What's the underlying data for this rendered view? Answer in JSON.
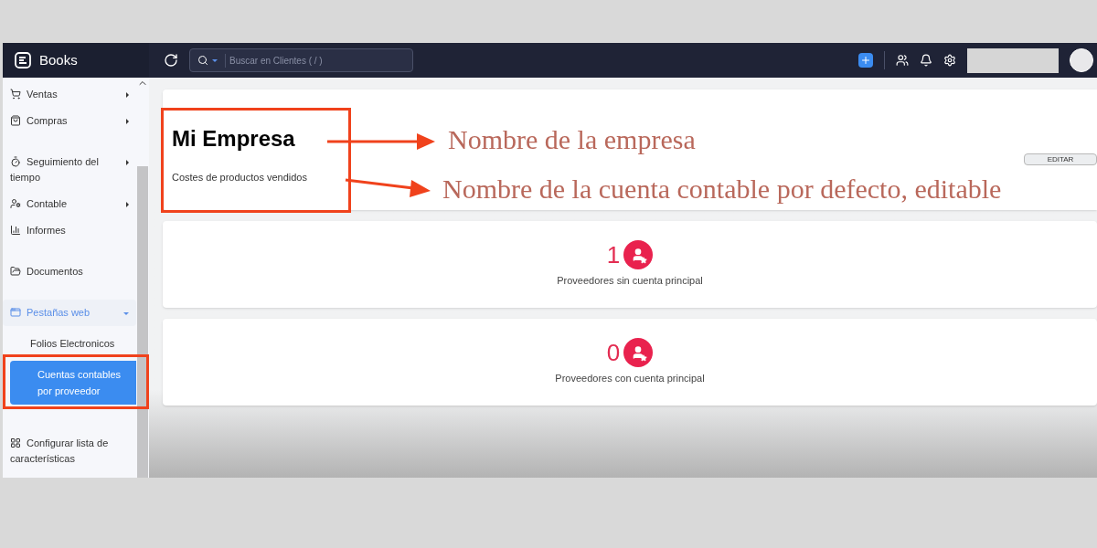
{
  "app": {
    "name": "Books"
  },
  "search": {
    "placeholder": "Buscar en Clientes ( / )"
  },
  "sidebar": {
    "items": [
      {
        "label": "Ventas",
        "expandable": true,
        "expanded": false,
        "active": false
      },
      {
        "label": "Compras",
        "expandable": true,
        "expanded": false,
        "active": false
      },
      {
        "label": "Seguimiento del tiempo",
        "expandable": true,
        "expanded": false,
        "active": false
      },
      {
        "label": "Contable",
        "expandable": true,
        "expanded": false,
        "active": false
      },
      {
        "label": "Informes",
        "expandable": false,
        "active": false
      },
      {
        "label": "Documentos",
        "expandable": false,
        "active": false
      },
      {
        "label": "Pestañas web",
        "expandable": true,
        "expanded": true,
        "active": true,
        "children": [
          {
            "label": "Folios Electronicos",
            "selected": false
          },
          {
            "label": "Cuentas contables por proveedor",
            "selected": true
          }
        ]
      }
    ],
    "footer_item": {
      "label": "Configurar lista de características"
    }
  },
  "company_card": {
    "title": "Mi Empresa",
    "account": "Costes de productos vendidos",
    "edit_button": "EDITAR"
  },
  "stats": [
    {
      "count": "1",
      "label": "Proveedores sin cuenta principal"
    },
    {
      "count": "0",
      "label": "Proveedores con cuenta principal"
    }
  ],
  "annotations": [
    {
      "text": "Nombre de la empresa"
    },
    {
      "text": "Nombre de la cuenta contable por defecto, editable"
    }
  ]
}
